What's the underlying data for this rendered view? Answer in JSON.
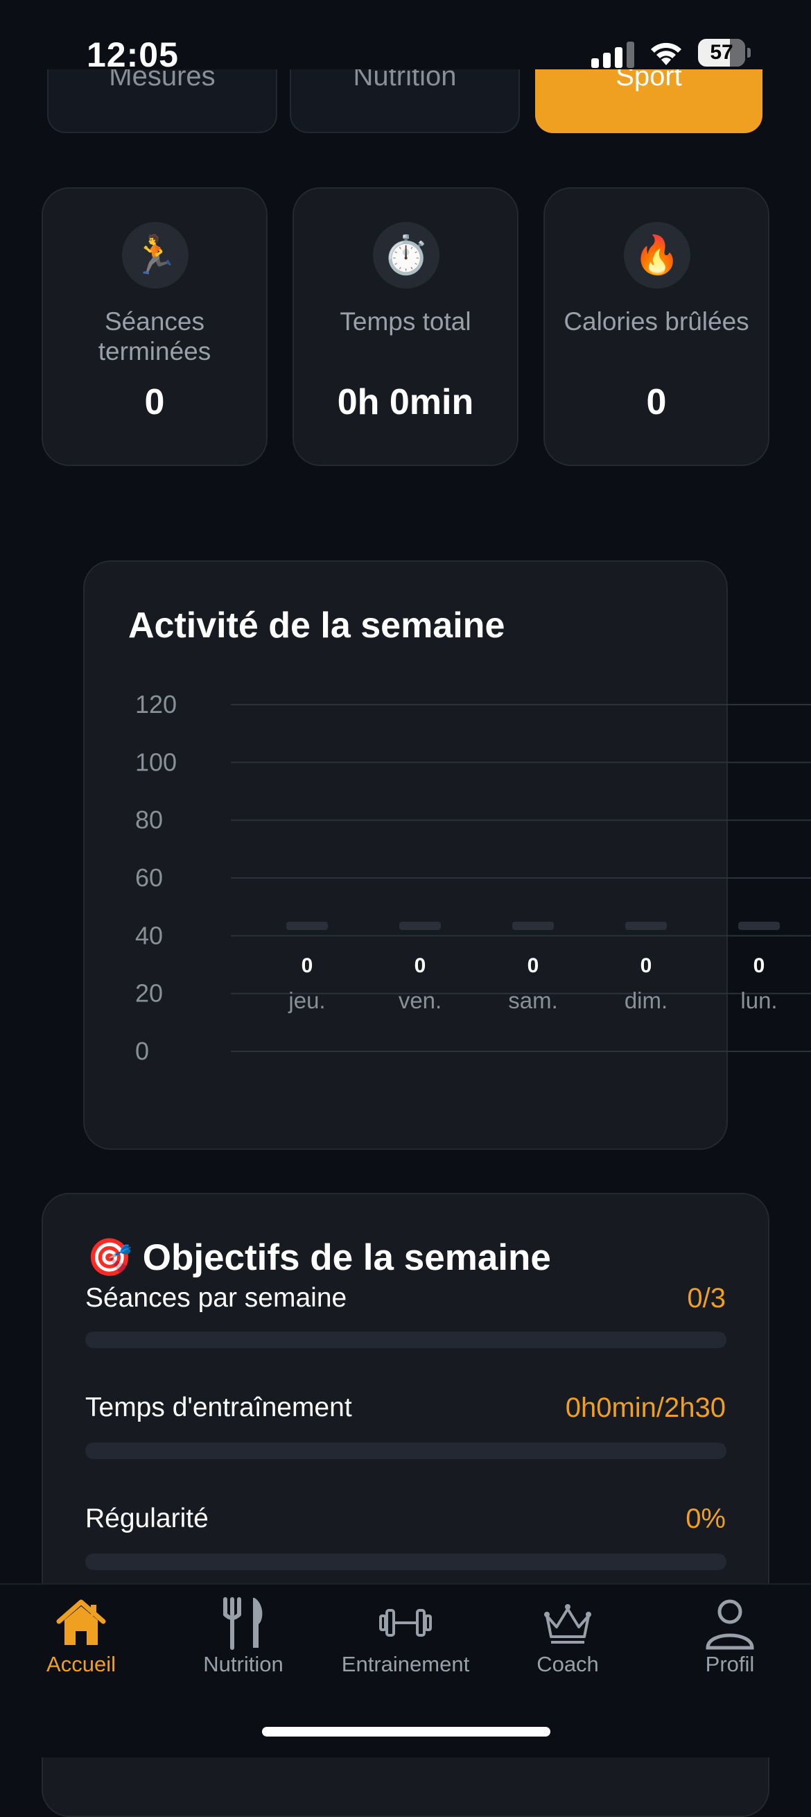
{
  "status_bar": {
    "time": "12:05",
    "battery": "57"
  },
  "segment_tabs": [
    {
      "label": "Mesures",
      "active": false
    },
    {
      "label": "Nutrition",
      "active": false
    },
    {
      "label": "Sport",
      "active": true
    }
  ],
  "stats": [
    {
      "icon": "runner-icon",
      "emoji": "🏃",
      "label": "Séances terminées",
      "value": "0"
    },
    {
      "icon": "stopwatch-icon",
      "emoji": "⏱️",
      "label": "Temps total",
      "value": "0h 0min"
    },
    {
      "icon": "fire-icon",
      "emoji": "🔥",
      "label": "Calories brûlées",
      "value": "0"
    }
  ],
  "weekly_activity": {
    "title": "Activité de la semaine"
  },
  "chart_data": {
    "type": "bar",
    "title": "Activité de la semaine",
    "categories": [
      "jeu.",
      "ven.",
      "sam.",
      "dim.",
      "lun."
    ],
    "values": [
      0,
      0,
      0,
      0,
      0
    ],
    "value_labels": [
      "0",
      "0",
      "0",
      "0",
      "0"
    ],
    "yticks": [
      "0",
      "20",
      "40",
      "60",
      "80",
      "100",
      "120"
    ],
    "ylim": [
      0,
      120
    ],
    "grid": true,
    "xlabel": "",
    "ylabel": ""
  },
  "goals": {
    "emoji": "🎯",
    "title": "Objectifs de la semaine",
    "items": [
      {
        "label": "Séances par semaine",
        "value": "0/3",
        "progress": 0
      },
      {
        "label": "Temps d'entraînement",
        "value": "0h0min/2h30",
        "progress": 0
      },
      {
        "label": "Régularité",
        "value": "0%",
        "progress": 0
      }
    ]
  },
  "bottom_nav": [
    {
      "label": "Accueil",
      "icon": "home-icon",
      "active": true
    },
    {
      "label": "Nutrition",
      "icon": "fork-knife-icon",
      "active": false
    },
    {
      "label": "Entrainement",
      "icon": "dumbbell-icon",
      "active": false
    },
    {
      "label": "Coach",
      "icon": "crown-icon",
      "active": false
    },
    {
      "label": "Profil",
      "icon": "person-icon",
      "active": false
    }
  ],
  "colors": {
    "accent": "#f0a020",
    "background": "#0b0e14",
    "card": "#171a21",
    "muted": "#9aa0aa"
  }
}
